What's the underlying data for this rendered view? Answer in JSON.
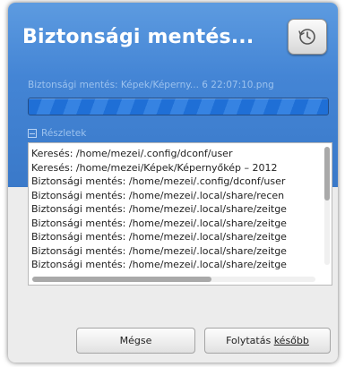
{
  "dialog": {
    "title": "Biztonsági mentés...",
    "history_icon": "history-clock-icon",
    "status_text": "Biztonsági mentés: Képek/Képerny... 6 22:07:10.png",
    "progress": 1.0,
    "details_label": "Részletek",
    "log_lines": [
      "Keresés: /home/mezei/.config/dconf/user",
      "Keresés: /home/mezei/Képek/Képernyőkép – 2012",
      "Biztonsági mentés: /home/mezei/.config/dconf/user",
      "Biztonsági mentés: /home/mezei/.local/share/recen",
      "Biztonsági mentés: /home/mezei/.local/share/zeitge",
      "Biztonsági mentés: /home/mezei/.local/share/zeitge",
      "Biztonsági mentés: /home/mezei/.local/share/zeitge",
      "Biztonsági mentés: /home/mezei/.local/share/zeitge",
      "Biztonsági mentés: /home/mezei/.local/share/zeitge"
    ],
    "cancel_label": "Mégse",
    "later_label_prefix": "Folytatás ",
    "later_label_underlined": "később"
  },
  "colors": {
    "header_blue": "#4485d5",
    "progress_fill": "#1f6fd6"
  }
}
